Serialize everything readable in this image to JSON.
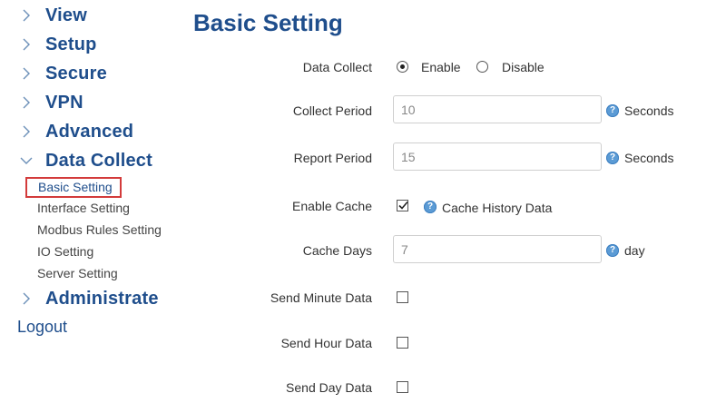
{
  "sidebar": {
    "items": [
      {
        "label": "View"
      },
      {
        "label": "Setup"
      },
      {
        "label": "Secure"
      },
      {
        "label": "VPN"
      },
      {
        "label": "Advanced"
      },
      {
        "label": "Data Collect"
      },
      {
        "label": "Administrate"
      }
    ],
    "sub_items": [
      {
        "label": "Basic Setting"
      },
      {
        "label": "Interface Setting"
      },
      {
        "label": "Modbus Rules Setting"
      },
      {
        "label": "IO Setting"
      },
      {
        "label": "Server Setting"
      }
    ],
    "logout": "Logout"
  },
  "main": {
    "title": "Basic Setting",
    "data_collect": {
      "label": "Data Collect",
      "enable_label": "Enable",
      "disable_label": "Disable",
      "selected": "Enable"
    },
    "collect_period": {
      "label": "Collect Period",
      "value": "10",
      "unit": "Seconds"
    },
    "report_period": {
      "label": "Report Period",
      "value": "15",
      "unit": "Seconds"
    },
    "enable_cache": {
      "label": "Enable Cache",
      "checked": true,
      "text": "Cache History Data"
    },
    "cache_days": {
      "label": "Cache Days",
      "value": "7",
      "unit": "day"
    },
    "send_minute": {
      "label": "Send Minute Data",
      "checked": false
    },
    "send_hour": {
      "label": "Send Hour Data",
      "checked": false
    },
    "send_day": {
      "label": "Send Day Data",
      "checked": false
    }
  },
  "colors": {
    "accent": "#1f4e8c",
    "highlight_border": "#d33b3b",
    "help_icon": "#5b9bd5"
  }
}
